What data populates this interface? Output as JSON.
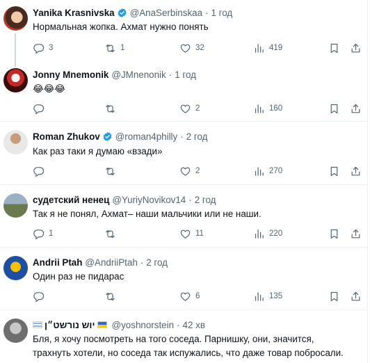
{
  "tweets": [
    {
      "name": "Yanika Krasnivska",
      "verified": true,
      "handle": "@AnaSerbinskaa",
      "time": "1 год",
      "text": "Нормальная жопка. Ахмат нужно понять",
      "replies": "3",
      "retweets": "1",
      "likes": "32",
      "views": "419"
    },
    {
      "name": "Jonny Mnemonik",
      "handle": "@JMnenonik",
      "time": "1 год",
      "text": "😂😂😂",
      "replies": "",
      "retweets": "",
      "likes": "2",
      "views": "160"
    },
    {
      "name": "Roman Zhukov",
      "verified": true,
      "handle": "@roman4philly",
      "time": "2 год",
      "text": "Как раз таки я думаю «взади»",
      "replies": "",
      "retweets": "",
      "likes": "2",
      "views": "270"
    },
    {
      "name": "судетский ненец",
      "handle": "@YuriyNovikov14",
      "time": "2 год",
      "text": "Так я не понял, Ахмат– наши мальчики или не наши.",
      "replies": "1",
      "retweets": "",
      "likes": "11",
      "views": "220"
    },
    {
      "name": "Andrii Ptah",
      "handle": "@AndriiPtah",
      "time": "2 год",
      "text": "Один раз не пидарас",
      "replies": "",
      "retweets": "",
      "likes": "6",
      "views": "135"
    },
    {
      "name": "יוש נורשט״ן",
      "handle": "@yoshnorstein",
      "time": "42 хв",
      "text": "Бля, я хочу посмотреть на того соседа. Парнишку, они, значится, трахнуть хотели, но соседа так испужались, что даже товар побросали."
    }
  ],
  "icons": {
    "reply": "reply-icon",
    "retweet": "retweet-icon",
    "like": "heart-icon",
    "views": "views-icon",
    "bookmark": "bookmark-icon",
    "share": "share-icon",
    "verified": "verified-badge-icon"
  },
  "colors": {
    "verified": "#1d9bf0",
    "muted": "#536471",
    "text": "#0f1419",
    "divider": "#eff3f4"
  }
}
